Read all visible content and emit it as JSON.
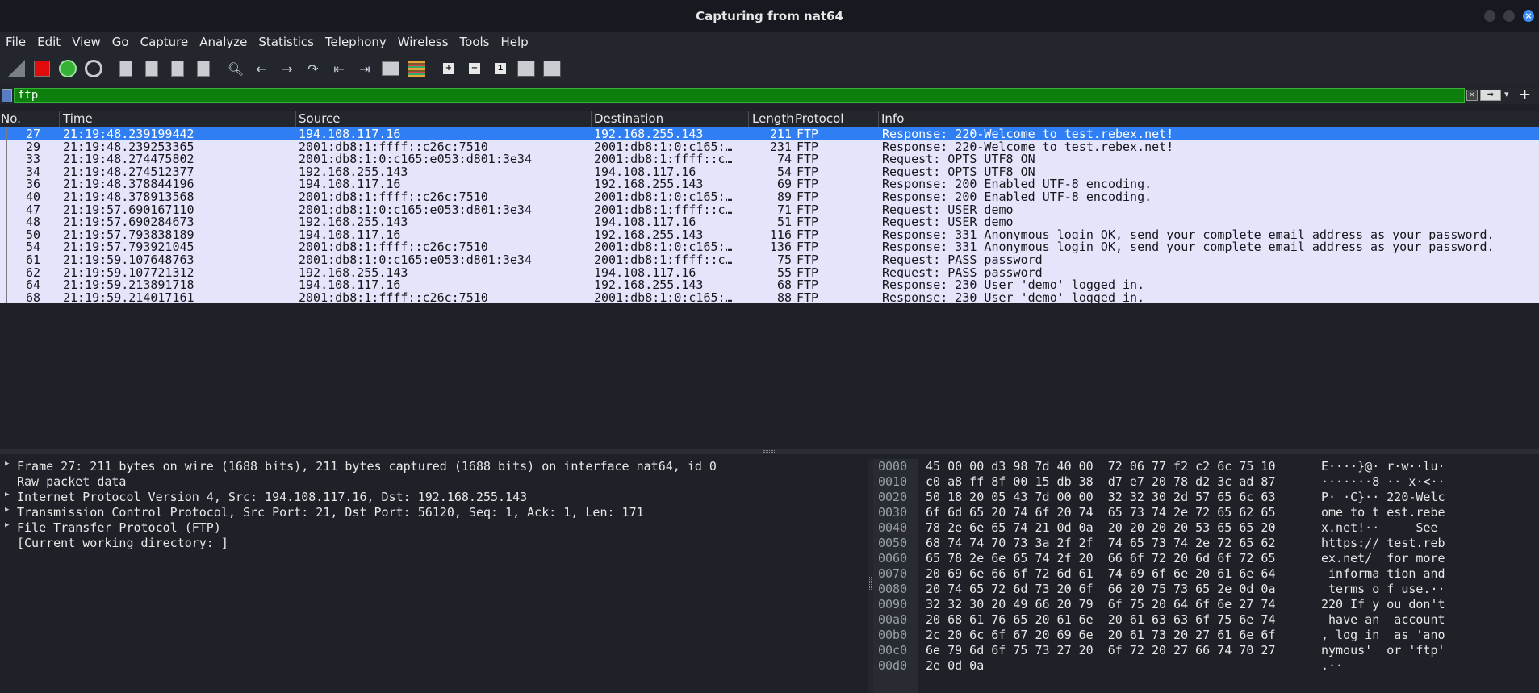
{
  "window": {
    "title": "Capturing from nat64"
  },
  "menu": [
    "File",
    "Edit",
    "View",
    "Go",
    "Capture",
    "Analyze",
    "Statistics",
    "Telephony",
    "Wireless",
    "Tools",
    "Help"
  ],
  "toolbar": {
    "icons": [
      "shark-fin-icon",
      "stop-capture-icon",
      "restart-capture-icon",
      "capture-options-icon",
      "open-file-icon",
      "save-file-icon",
      "close-file-icon",
      "reload-file-icon",
      "find-packet-icon",
      "go-back-icon",
      "go-forward-icon",
      "go-to-packet-icon",
      "first-packet-icon",
      "last-packet-icon",
      "auto-scroll-icon",
      "colorize-icon",
      "zoom-in-icon",
      "zoom-out-icon",
      "normal-size-icon",
      "resize-columns-icon",
      "expand-subtrees-icon"
    ]
  },
  "filter": {
    "value": "ftp",
    "clear_glyph": "×",
    "apply_glyph": "➡",
    "add_glyph": "+"
  },
  "columns": [
    "No.",
    "Time",
    "Source",
    "Destination",
    "Length",
    "Protocol",
    "Info"
  ],
  "packets": [
    {
      "no": "27",
      "time": "21:19:48.239199442",
      "src": "194.108.117.16",
      "dst": "192.168.255.143",
      "len": "211",
      "proto": "FTP",
      "info": "Response: 220-Welcome to test.rebex.net!"
    },
    {
      "no": "29",
      "time": "21:19:48.239253365",
      "src": "2001:db8:1:ffff::c26c:7510",
      "dst": "2001:db8:1:0:c165:…",
      "len": "231",
      "proto": "FTP",
      "info": "Response: 220-Welcome to test.rebex.net!"
    },
    {
      "no": "33",
      "time": "21:19:48.274475802",
      "src": "2001:db8:1:0:c165:e053:d801:3e34",
      "dst": "2001:db8:1:ffff::c…",
      "len": "74",
      "proto": "FTP",
      "info": "Request: OPTS UTF8 ON"
    },
    {
      "no": "34",
      "time": "21:19:48.274512377",
      "src": "192.168.255.143",
      "dst": "194.108.117.16",
      "len": "54",
      "proto": "FTP",
      "info": "Request: OPTS UTF8 ON"
    },
    {
      "no": "36",
      "time": "21:19:48.378844196",
      "src": "194.108.117.16",
      "dst": "192.168.255.143",
      "len": "69",
      "proto": "FTP",
      "info": "Response: 200 Enabled UTF-8 encoding."
    },
    {
      "no": "40",
      "time": "21:19:48.378913568",
      "src": "2001:db8:1:ffff::c26c:7510",
      "dst": "2001:db8:1:0:c165:…",
      "len": "89",
      "proto": "FTP",
      "info": "Response: 200 Enabled UTF-8 encoding."
    },
    {
      "no": "47",
      "time": "21:19:57.690167110",
      "src": "2001:db8:1:0:c165:e053:d801:3e34",
      "dst": "2001:db8:1:ffff::c…",
      "len": "71",
      "proto": "FTP",
      "info": "Request: USER demo"
    },
    {
      "no": "48",
      "time": "21:19:57.690284673",
      "src": "192.168.255.143",
      "dst": "194.108.117.16",
      "len": "51",
      "proto": "FTP",
      "info": "Request: USER demo"
    },
    {
      "no": "50",
      "time": "21:19:57.793838189",
      "src": "194.108.117.16",
      "dst": "192.168.255.143",
      "len": "116",
      "proto": "FTP",
      "info": "Response: 331 Anonymous login OK, send your complete email address as your password."
    },
    {
      "no": "54",
      "time": "21:19:57.793921045",
      "src": "2001:db8:1:ffff::c26c:7510",
      "dst": "2001:db8:1:0:c165:…",
      "len": "136",
      "proto": "FTP",
      "info": "Response: 331 Anonymous login OK, send your complete email address as your password."
    },
    {
      "no": "61",
      "time": "21:19:59.107648763",
      "src": "2001:db8:1:0:c165:e053:d801:3e34",
      "dst": "2001:db8:1:ffff::c…",
      "len": "75",
      "proto": "FTP",
      "info": "Request: PASS password"
    },
    {
      "no": "62",
      "time": "21:19:59.107721312",
      "src": "192.168.255.143",
      "dst": "194.108.117.16",
      "len": "55",
      "proto": "FTP",
      "info": "Request: PASS password"
    },
    {
      "no": "64",
      "time": "21:19:59.213891718",
      "src": "194.108.117.16",
      "dst": "192.168.255.143",
      "len": "68",
      "proto": "FTP",
      "info": "Response: 230 User 'demo' logged in."
    },
    {
      "no": "68",
      "time": "21:19:59.214017161",
      "src": "2001:db8:1:ffff::c26c:7510",
      "dst": "2001:db8:1:0:c165:…",
      "len": "88",
      "proto": "FTP",
      "info": "Response: 230 User 'demo' logged in."
    }
  ],
  "selected_packet": "27",
  "details": [
    {
      "expandable": true,
      "text": "Frame 27: 211 bytes on wire (1688 bits), 211 bytes captured (1688 bits) on interface nat64, id 0"
    },
    {
      "expandable": false,
      "text": "Raw packet data"
    },
    {
      "expandable": true,
      "text": "Internet Protocol Version 4, Src: 194.108.117.16, Dst: 192.168.255.143"
    },
    {
      "expandable": true,
      "text": "Transmission Control Protocol, Src Port: 21, Dst Port: 56120, Seq: 1, Ack: 1, Len: 171"
    },
    {
      "expandable": true,
      "text": "File Transfer Protocol (FTP)"
    },
    {
      "expandable": false,
      "text": "[Current working directory: ]"
    }
  ],
  "bytes": [
    {
      "off": "0000",
      "hex": "45 00 00 d3 98 7d 40 00  72 06 77 f2 c2 6c 75 10",
      "ascii": "E····}@· r·w··lu·"
    },
    {
      "off": "0010",
      "hex": "c0 a8 ff 8f 00 15 db 38  d7 e7 20 78 d2 3c ad 87",
      "ascii": "·······8 ·· x·<··"
    },
    {
      "off": "0020",
      "hex": "50 18 20 05 43 7d 00 00  32 32 30 2d 57 65 6c 63",
      "ascii": "P· ·C}·· 220-Welc"
    },
    {
      "off": "0030",
      "hex": "6f 6d 65 20 74 6f 20 74  65 73 74 2e 72 65 62 65",
      "ascii": "ome to t est.rebe"
    },
    {
      "off": "0040",
      "hex": "78 2e 6e 65 74 21 0d 0a  20 20 20 20 53 65 65 20",
      "ascii": "x.net!··     See "
    },
    {
      "off": "0050",
      "hex": "68 74 74 70 73 3a 2f 2f  74 65 73 74 2e 72 65 62",
      "ascii": "https:// test.reb"
    },
    {
      "off": "0060",
      "hex": "65 78 2e 6e 65 74 2f 20  66 6f 72 20 6d 6f 72 65",
      "ascii": "ex.net/  for more"
    },
    {
      "off": "0070",
      "hex": "20 69 6e 66 6f 72 6d 61  74 69 6f 6e 20 61 6e 64",
      "ascii": " informa tion and"
    },
    {
      "off": "0080",
      "hex": "20 74 65 72 6d 73 20 6f  66 20 75 73 65 2e 0d 0a",
      "ascii": " terms o f use.··"
    },
    {
      "off": "0090",
      "hex": "32 32 30 20 49 66 20 79  6f 75 20 64 6f 6e 27 74",
      "ascii": "220 If y ou don't"
    },
    {
      "off": "00a0",
      "hex": "20 68 61 76 65 20 61 6e  20 61 63 63 6f 75 6e 74",
      "ascii": " have an  account"
    },
    {
      "off": "00b0",
      "hex": "2c 20 6c 6f 67 20 69 6e  20 61 73 20 27 61 6e 6f",
      "ascii": ", log in  as 'ano"
    },
    {
      "off": "00c0",
      "hex": "6e 79 6d 6f 75 73 27 20  6f 72 20 27 66 74 70 27",
      "ascii": "nymous'  or 'ftp'"
    },
    {
      "off": "00d0",
      "hex": "2e 0d 0a",
      "ascii": ".··"
    }
  ]
}
